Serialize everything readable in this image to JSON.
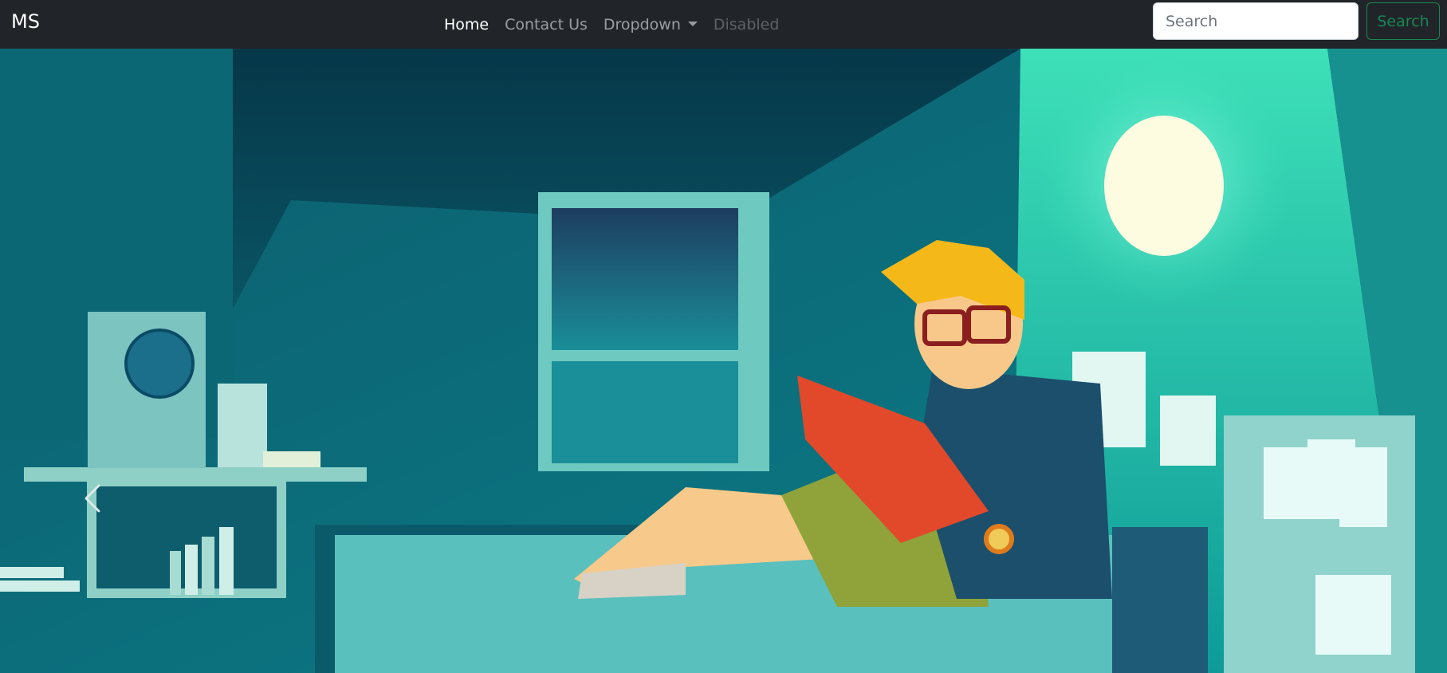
{
  "navbar": {
    "brand": "MS",
    "links": [
      {
        "label": "Home",
        "state": "active"
      },
      {
        "label": "Contact Us",
        "state": "default"
      },
      {
        "label": "Dropdown",
        "state": "dropdown"
      },
      {
        "label": "Disabled",
        "state": "disabled"
      }
    ],
    "search": {
      "placeholder": "Search",
      "button_label": "Search"
    }
  },
  "carousel": {
    "slide_image": "cartoon-reading-room-illustration",
    "prev_icon": "chevron-left-icon"
  },
  "colors": {
    "navbar_bg": "#212529",
    "search_button": "#198754",
    "room_teal": "#0f7f88",
    "lamp_glow": "#3de0b8"
  }
}
